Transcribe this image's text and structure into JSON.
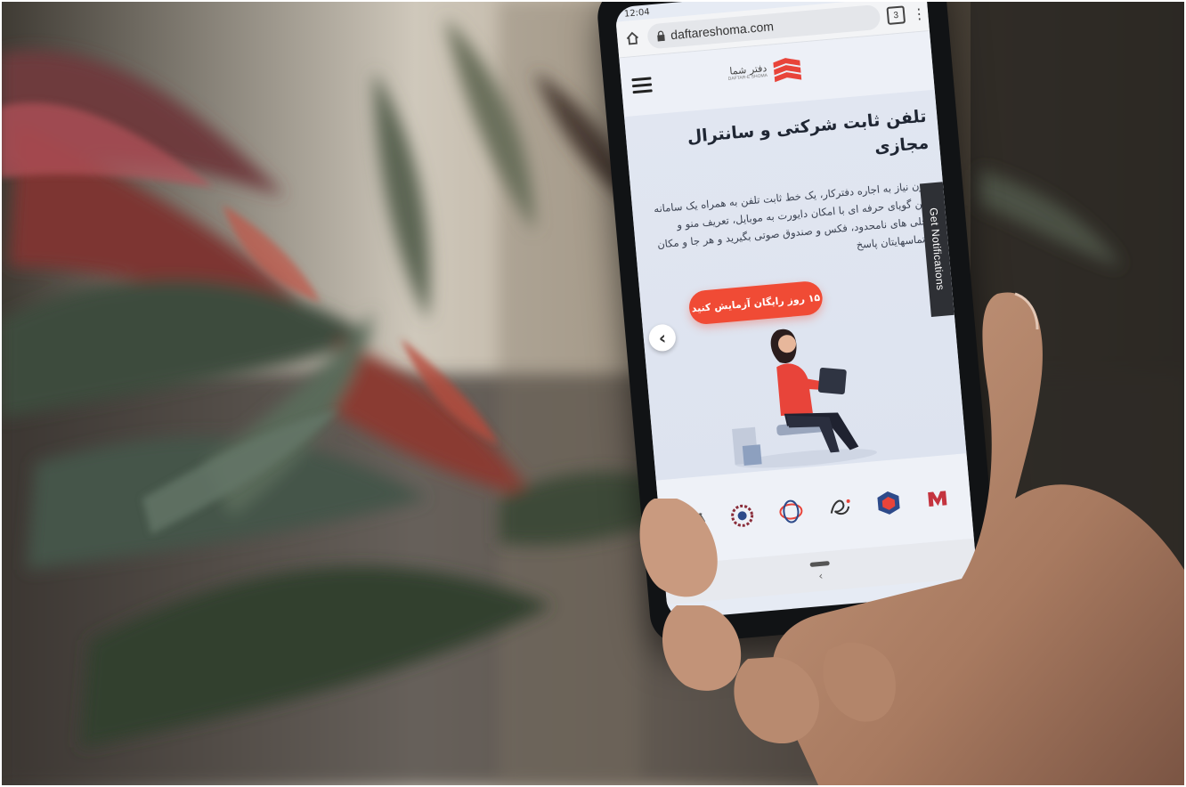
{
  "status_bar": {
    "time": "12:04"
  },
  "browser": {
    "url": "daftareshoma.com",
    "tab_count": "3",
    "menu_glyph": "⋮",
    "icons": [
      "home-icon",
      "lock-icon",
      "tabs-icon",
      "more-vert-icon"
    ]
  },
  "site": {
    "logo_text": "دفتر شما",
    "logo_subtext": "DAFTAR-E SHOMA",
    "brand_color": "#e8443a",
    "hero_title": "تلفن ثابت شرکتی و سانترال مجازی",
    "hero_description": "بدون نیاز به اجاره دفترکار، یک خط ثابت تلفن به همراه یک سامانه تلفن گویای حرفه ای با امکان دایورت به موبایل، تعریف منو و داخلی های نامحدود، فکس و صندوق صوتی بگیرید و هر جا و مکان به تماسهایتان پاسخ",
    "cta_label": "۱۵ روز رایگان آزمایش کنید",
    "cta_color": "#f04b35",
    "carousel_prev_glyph": "‹",
    "notification_tab": "Get Notifications"
  },
  "partners": [
    "partner-logo-1",
    "partner-logo-2",
    "partner-logo-3",
    "partner-logo-4",
    "partner-logo-5",
    "partner-logo-6"
  ],
  "system_nav": {
    "back_glyph": "‹"
  }
}
